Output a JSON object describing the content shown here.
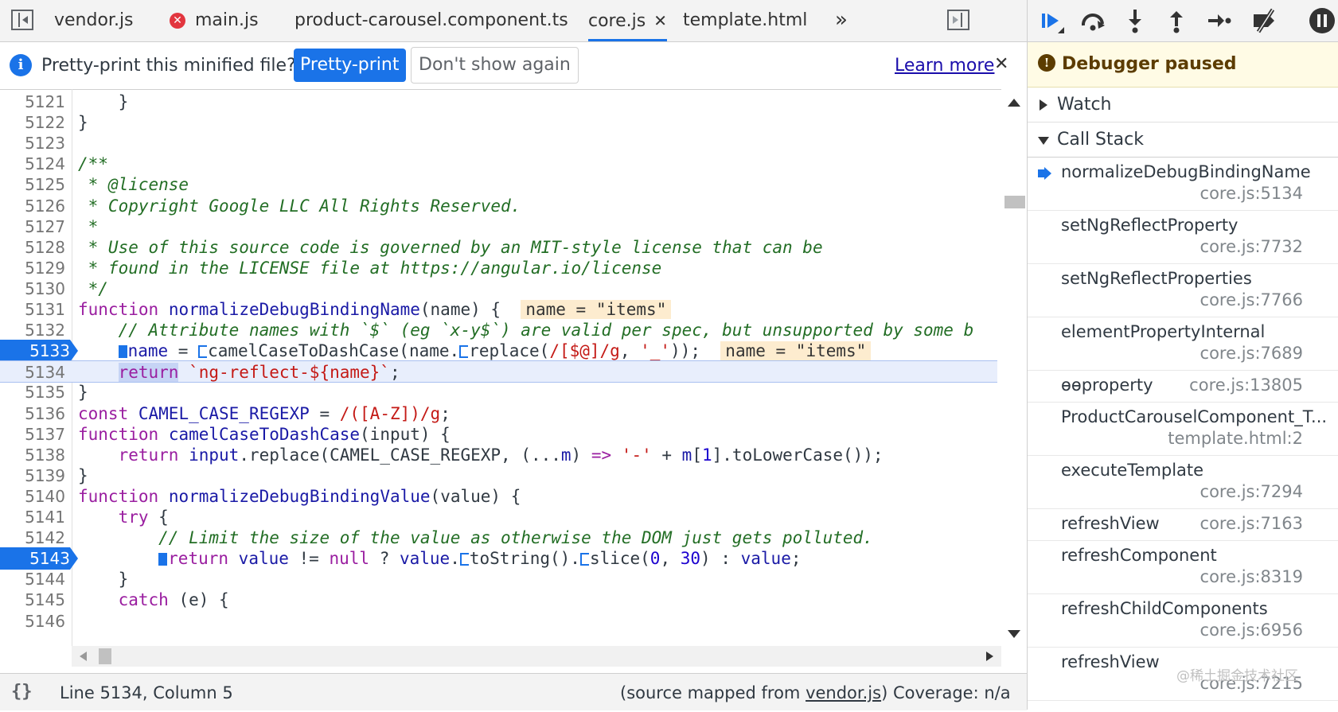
{
  "tabs": [
    {
      "label": "vendor.js",
      "error": false,
      "active": false
    },
    {
      "label": "main.js",
      "error": true,
      "active": false
    },
    {
      "label": "product-carousel.component.ts",
      "error": false,
      "active": false
    },
    {
      "label": "core.js",
      "error": false,
      "active": true,
      "close": "✕"
    },
    {
      "label": "template.html",
      "error": false,
      "active": false
    }
  ],
  "tabs_overflow": "»",
  "infobar": {
    "icon_glyph": "i",
    "message": "Pretty-print this minified file?",
    "pretty_print": "Pretty-print",
    "dont_show": "Don't show again",
    "learn_more": "Learn more",
    "close": "✕"
  },
  "code": [
    {
      "n": "5121",
      "html": "    }"
    },
    {
      "n": "5122",
      "html": "}"
    },
    {
      "n": "5123",
      "html": ""
    },
    {
      "n": "5124",
      "html": "<span class=\"cm\">/**</span>"
    },
    {
      "n": "5125",
      "html": "<span class=\"cm\"> * @license</span>"
    },
    {
      "n": "5126",
      "html": "<span class=\"cm\"> * Copyright Google LLC All Rights Reserved.</span>"
    },
    {
      "n": "5127",
      "html": "<span class=\"cm\"> *</span>"
    },
    {
      "n": "5128",
      "html": "<span class=\"cm\"> * Use of this source code is governed by an MIT-style license that can be</span>"
    },
    {
      "n": "5129",
      "html": "<span class=\"cm\"> * found in the LICENSE file at https://angular.io/license</span>"
    },
    {
      "n": "5130",
      "html": "<span class=\"cm\"> */</span>"
    },
    {
      "n": "5131",
      "html": "<span class=\"kw\">function</span> <span class=\"fn\">normalizeDebugBindingName</span>(name) {  <span class=\"inline-val\">name = \"items\"</span>"
    },
    {
      "n": "5132",
      "html": "    <span class=\"cm\">// Attribute names with `$` (eg `x-y$`) are valid per spec, but unsupported by some b</span>"
    },
    {
      "n": "5133",
      "bp": true,
      "html": "    <span class=\"marker fill\"></span><span class=\"var\">name</span> = <span class=\"marker\"></span>camelCaseToDashCase(name.<span class=\"marker\"></span>replace(<span class=\"str\">/[$@]/g</span>, <span class=\"str\">'_'</span>));  <span class=\"inline-val\">name = \"items\"</span>"
    },
    {
      "n": "5134",
      "cur": true,
      "html": "    <span class=\"kw ret-hl\">return</span> <span class=\"str\">`ng-reflect-${name}`</span>;"
    },
    {
      "n": "5135",
      "html": "}"
    },
    {
      "n": "5136",
      "html": "<span class=\"kw\">const</span> <span class=\"var\">CAMEL_CASE_REGEXP</span> = <span class=\"str\">/([A-Z])/g</span>;"
    },
    {
      "n": "5137",
      "html": "<span class=\"kw\">function</span> <span class=\"fn\">camelCaseToDashCase</span>(input) {"
    },
    {
      "n": "5138",
      "html": "    <span class=\"kw\">return</span> <span class=\"var\">input</span>.replace(CAMEL_CASE_REGEXP, (...<span class=\"var\">m</span>) <span class=\"kw\">=&gt;</span> <span class=\"str\">'-'</span> + <span class=\"var\">m</span>[<span class=\"num\">1</span>].toLowerCase());"
    },
    {
      "n": "5139",
      "html": "}"
    },
    {
      "n": "5140",
      "html": "<span class=\"kw\">function</span> <span class=\"fn\">normalizeDebugBindingValue</span>(value) {"
    },
    {
      "n": "5141",
      "html": "    <span class=\"kw\">try</span> {"
    },
    {
      "n": "5142",
      "html": "        <span class=\"cm\">// Limit the size of the value as otherwise the DOM just gets polluted.</span>"
    },
    {
      "n": "5143",
      "bp": true,
      "html": "        <span class=\"marker fill\"></span><span class=\"kw\">return</span> <span class=\"var\">value</span> != <span class=\"kw\">null</span> ? <span class=\"var\">value</span>.<span class=\"marker\"></span>toString().<span class=\"marker\"></span>slice(<span class=\"num\">0</span>, <span class=\"num\">30</span>) : <span class=\"var\">value</span>;"
    },
    {
      "n": "5144",
      "html": "    }"
    },
    {
      "n": "5145",
      "html": "    <span class=\"kw\">catch</span> (e) {"
    },
    {
      "n": "5146",
      "html": ""
    }
  ],
  "status": {
    "braces": "{}",
    "position": "Line 5134, Column 5",
    "mapped_prefix": "(source mapped from ",
    "mapped_link": "vendor.js",
    "mapped_suffix": ")",
    "coverage": "Coverage: n/a"
  },
  "debugger": {
    "paused_icon": "!",
    "paused": "Debugger paused",
    "watch": "Watch",
    "call_stack": "Call Stack",
    "frames": [
      {
        "name": "normalizeDebugBindingName",
        "loc": "core.js:5134",
        "current": true
      },
      {
        "name": "setNgReflectProperty",
        "loc": "core.js:7732"
      },
      {
        "name": "setNgReflectProperties",
        "loc": "core.js:7766"
      },
      {
        "name": "elementPropertyInternal",
        "loc": "core.js:7689"
      },
      {
        "name": "ɵɵproperty",
        "loc": "core.js:13805",
        "inline": true
      },
      {
        "name": "ProductCarouselComponent_T...",
        "loc": "template.html:2"
      },
      {
        "name": "executeTemplate",
        "loc": "core.js:7294"
      },
      {
        "name": "refreshView",
        "loc": "core.js:7163",
        "inline": true
      },
      {
        "name": "refreshComponent",
        "loc": "core.js:8319"
      },
      {
        "name": "refreshChildComponents",
        "loc": "core.js:6956"
      },
      {
        "name": "refreshView",
        "loc": "core.js:7215"
      }
    ]
  },
  "watermark": "@稀土掘金技术社区",
  "colors": {
    "accent": "#1a73e8",
    "paused_bg": "#fffbe5",
    "keyword": "#9a1ea0",
    "comment": "#236e25",
    "string": "#c41a16"
  }
}
